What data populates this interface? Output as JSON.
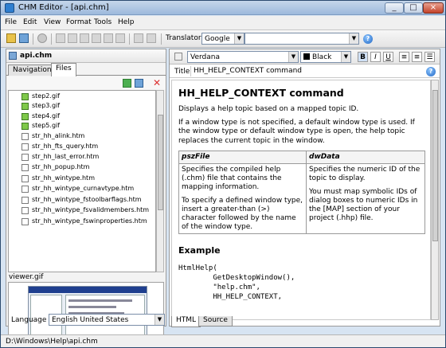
{
  "window": {
    "title": "CHM Editor - [api.chm]"
  },
  "menu": [
    "File",
    "Edit",
    "View",
    "Format",
    "Tools",
    "Help"
  ],
  "toolbar": {
    "translator_label": "Translator",
    "translator_value": "Google",
    "translator_text": ""
  },
  "left_panel": {
    "file_title": "api.chm",
    "tabs": [
      "Navigation",
      "Files"
    ],
    "files": [
      {
        "name": "step2.gif",
        "type": "gif"
      },
      {
        "name": "step3.gif",
        "type": "gif"
      },
      {
        "name": "step4.gif",
        "type": "gif"
      },
      {
        "name": "step5.gif",
        "type": "gif"
      },
      {
        "name": "str_hh_alink.htm",
        "type": "htm"
      },
      {
        "name": "str_hh_fts_query.htm",
        "type": "htm"
      },
      {
        "name": "str_hh_last_error.htm",
        "type": "htm"
      },
      {
        "name": "str_hh_popup.htm",
        "type": "htm"
      },
      {
        "name": "str_hh_wintype.htm",
        "type": "htm"
      },
      {
        "name": "str_hh_wintype_curnavtype.htm",
        "type": "htm"
      },
      {
        "name": "str_hh_wintype_fstoolbarflags.htm",
        "type": "htm"
      },
      {
        "name": "str_hh_wintype_fsvalidmembers.htm",
        "type": "htm"
      },
      {
        "name": "str_hh_wintype_fswinproperties.htm",
        "type": "htm"
      }
    ],
    "preview_label": "viewer.gif",
    "language_label": "Language",
    "language_value": "English United States"
  },
  "editor": {
    "font": "Verdana",
    "color": "Black",
    "bold": "B",
    "italic": "I",
    "underline": "U",
    "title_label": "Title",
    "title_value": "HH_HELP_CONTEXT command",
    "heading": "HH_HELP_CONTEXT command",
    "para1": "Displays a help topic based on a mapped topic ID.",
    "para2": "If a window type is not specified, a default window type is used. If the window type or default window type is open, the help topic replaces the current topic in the window.",
    "table": {
      "headers": [
        "pszFile",
        "dwData"
      ],
      "col1": [
        "Specifies the compiled help (.chm) file that contains the mapping information.",
        "To specify a defined window type, insert a greater-than (>) character followed by the name of the window type."
      ],
      "col2": [
        "Specifies the numeric ID of the topic to display.",
        "You must map symbolic IDs of dialog boxes to numeric IDs in the [MAP] section of your project (.hhp) file."
      ]
    },
    "example_heading": "Example",
    "code": "HtmlHelp(\n        GetDesktopWindow(),\n        \"help.chm\",\n        HH_HELP_CONTEXT,",
    "bottom_tabs": [
      "HTML",
      "Source"
    ]
  },
  "status": {
    "path": "D:\\Windows\\Help\\api.chm"
  },
  "colors": {
    "accent": "#2f7fd0",
    "titlebar": "#9db9dc",
    "close": "#c3432a"
  }
}
